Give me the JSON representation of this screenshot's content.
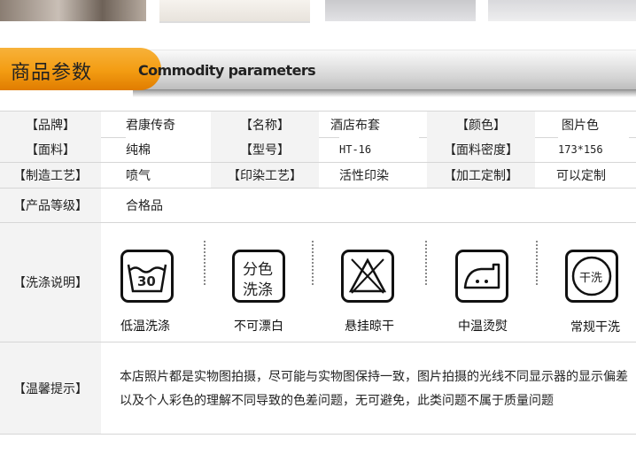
{
  "header": {
    "title_cn": "商品参数",
    "title_en": "Commodity parameters"
  },
  "params": [
    [
      {
        "label": "【品牌】",
        "value": "君康传奇"
      },
      {
        "label": "【名称】",
        "value": "酒店布套"
      },
      {
        "label": "【颜色】",
        "value": "图片色"
      }
    ],
    [
      {
        "label": "【面料】",
        "value": "纯棉"
      },
      {
        "label": "【型号】",
        "value": "HT-16"
      },
      {
        "label": "【面料密度】",
        "value": "173*156"
      }
    ],
    [
      {
        "label": "【制造工艺】",
        "value": "喷气"
      },
      {
        "label": "【印染工艺】",
        "value": "活性印染"
      },
      {
        "label": "【加工定制】",
        "value": "可以定制"
      }
    ]
  ],
  "grade": {
    "label": "【产品等级】",
    "value": "合格品"
  },
  "wash": {
    "label": "【洗涤说明】",
    "items": [
      {
        "icon": "wash-30-icon",
        "badge": "30",
        "caption": "低温洗涤"
      },
      {
        "icon": "no-bleach-icon",
        "badge_top": "分色",
        "badge_bottom": "洗涤",
        "caption": "不可漂白"
      },
      {
        "icon": "hang-dry-icon",
        "caption": "悬挂晾干"
      },
      {
        "icon": "iron-medium-icon",
        "caption": "中温烫熨"
      },
      {
        "icon": "dry-clean-icon",
        "badge": "干洗",
        "caption": "常规干洗"
      }
    ]
  },
  "notice": {
    "label": "【温馨提示】",
    "text": "本店照片都是实物图拍摄，尽可能与实物图保持一致，图片拍摄的光线不同显示器的显示偏差以及个人彩色的理解不同导致的色差问题，无可避免，此类问题不属于质量问题"
  }
}
